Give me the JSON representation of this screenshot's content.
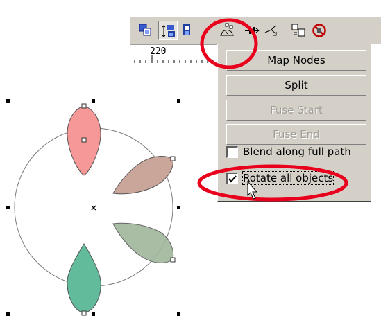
{
  "toolbar": {
    "icons": [
      "front-back-icon",
      "blend-icon",
      "order-icon",
      "blend-options-icon",
      "path-icon",
      "node-icon",
      "copy-properties-icon",
      "clear-blend-icon"
    ]
  },
  "ruler": {
    "label": "220"
  },
  "blend_popup": {
    "buttons": [
      {
        "label": "Map Nodes",
        "enabled": true
      },
      {
        "label": "Split",
        "enabled": true
      },
      {
        "label": "Fuse Start",
        "enabled": false
      },
      {
        "label": "Fuse End",
        "enabled": false
      }
    ],
    "checkboxes": [
      {
        "label": "Blend along full path",
        "checked": false
      },
      {
        "label": "Rotate all objects",
        "checked": true
      }
    ]
  },
  "colors": {
    "petal_start": "#f79898",
    "petal_2": "#c9a59a",
    "petal_3": "#9fb69a",
    "petal_end": "#62bc9b",
    "highlight": "#e8001c",
    "ui_face": "#d4d0c8"
  }
}
